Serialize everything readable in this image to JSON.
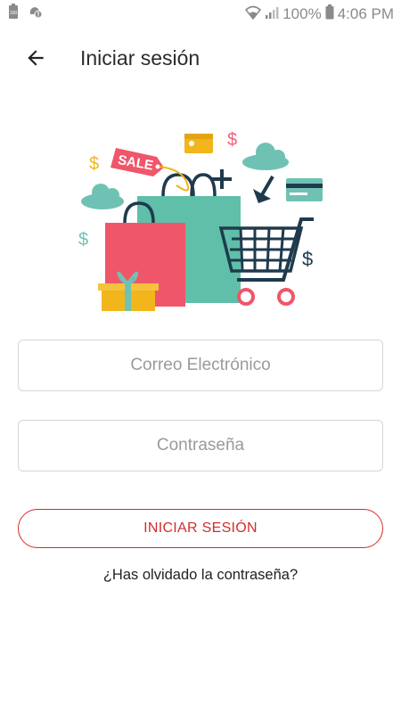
{
  "status_bar": {
    "notification_icons": [
      "battery-100-notification-icon",
      "alert-notification-icon"
    ],
    "battery_percent": "100%",
    "time": "4:06 PM",
    "icons": [
      "wifi-icon",
      "signal-icon",
      "battery-icon"
    ]
  },
  "header": {
    "back_icon": "arrow-left-icon",
    "title": "Iniciar sesión"
  },
  "hero": {
    "sale_tag": "SALE"
  },
  "form": {
    "email_placeholder": "Correo Electrónico",
    "email_value": "",
    "password_placeholder": "Contraseña",
    "password_value": "",
    "submit_label": "INICIAR SESIÓN",
    "forgot_password": "¿Has olvidado la contraseña?"
  },
  "colors": {
    "accent": "#d22b2b",
    "field_border": "#d6d6d6",
    "placeholder": "#9a9a9a"
  }
}
